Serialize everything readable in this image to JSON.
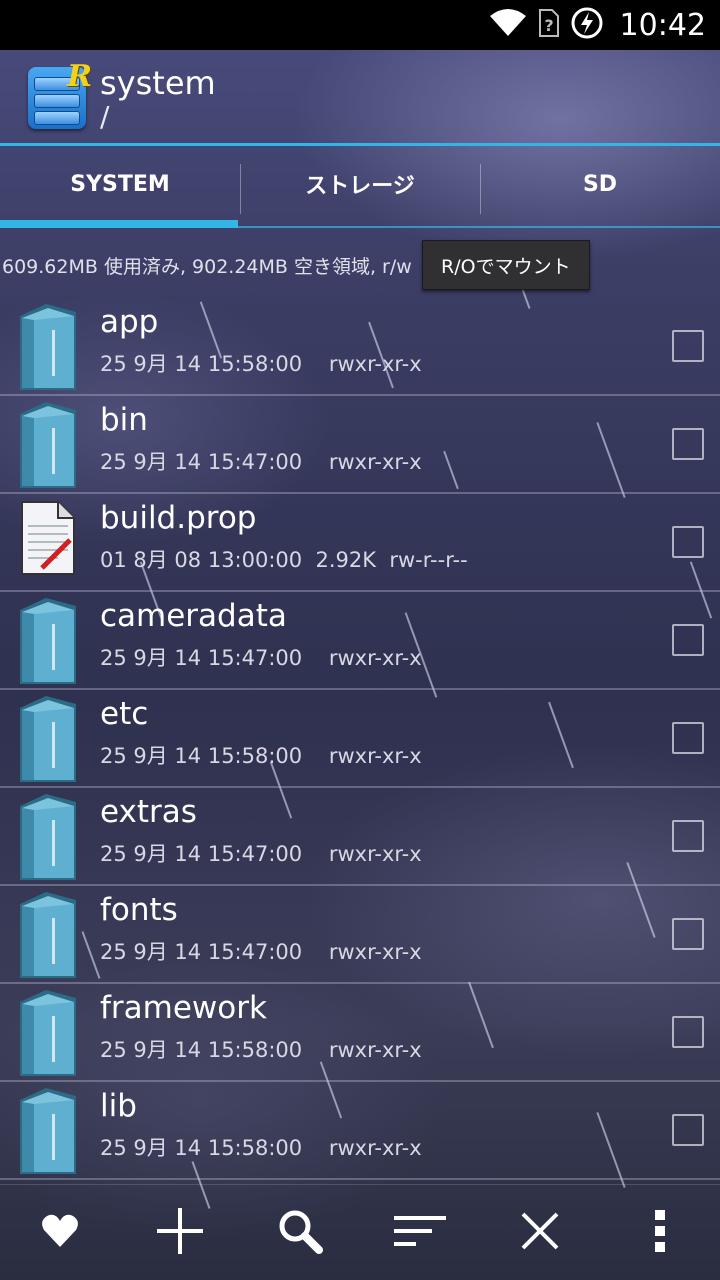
{
  "status_bar": {
    "time": "10:42",
    "icons": [
      "wifi-icon",
      "no-sim-icon",
      "battery-charging-icon"
    ]
  },
  "header": {
    "title": "system",
    "path": "/"
  },
  "tabs": [
    {
      "label": "SYSTEM",
      "active": true
    },
    {
      "label": "ストレージ",
      "active": false
    },
    {
      "label": "SD",
      "active": false
    }
  ],
  "storage": {
    "info": "609.62MB 使用済み, 902.24MB 空き領域, r/w",
    "mount_button": "R/Oでマウント"
  },
  "files": [
    {
      "name": "app",
      "type": "folder",
      "meta": "25 9月 14 15:58:00    rwxr-xr-x"
    },
    {
      "name": "bin",
      "type": "folder",
      "meta": "25 9月 14 15:47:00    rwxr-xr-x"
    },
    {
      "name": "build.prop",
      "type": "file",
      "meta": "01 8月 08 13:00:00  2.92K  rw-r--r--"
    },
    {
      "name": "cameradata",
      "type": "folder",
      "meta": "25 9月 14 15:47:00    rwxr-xr-x"
    },
    {
      "name": "etc",
      "type": "folder",
      "meta": "25 9月 14 15:58:00    rwxr-xr-x"
    },
    {
      "name": "extras",
      "type": "folder",
      "meta": "25 9月 14 15:47:00    rwxr-xr-x"
    },
    {
      "name": "fonts",
      "type": "folder",
      "meta": "25 9月 14 15:47:00    rwxr-xr-x"
    },
    {
      "name": "framework",
      "type": "folder",
      "meta": "25 9月 14 15:58:00    rwxr-xr-x"
    },
    {
      "name": "lib",
      "type": "folder",
      "meta": "25 9月 14 15:58:00    rwxr-xr-x"
    }
  ],
  "toolbar": [
    "heart-icon",
    "plus-icon",
    "search-icon",
    "sort-icon",
    "close-icon",
    "overflow-menu-icon"
  ],
  "colors": {
    "accent": "#33b5e5",
    "status_bar": "#000000"
  }
}
